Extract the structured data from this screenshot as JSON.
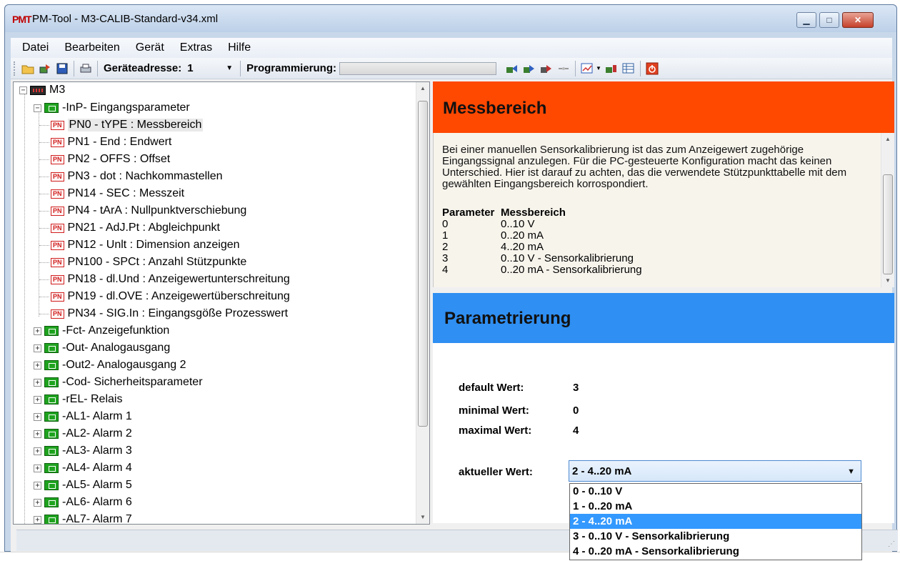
{
  "window": {
    "logo": "PMT",
    "title": "PM-Tool - M3-CALIB-Standard-v34.xml",
    "controls": {
      "minimize": "▁",
      "maximize": "□",
      "close": "✕"
    }
  },
  "menu": [
    "Datei",
    "Bearbeiten",
    "Gerät",
    "Extras",
    "Hilfe"
  ],
  "toolbar": {
    "address_label": "Geräteadresse:",
    "address_value": "1",
    "programming_label": "Programmierung:",
    "icons": [
      "open-folder-icon",
      "device-read-icon",
      "save-icon",
      "print-icon",
      "device-transfer-icon",
      "device-sync-icon",
      "device-upload-icon",
      "disconnect-icon",
      "chart-icon",
      "device-download-icon",
      "table-icon",
      "power-icon"
    ]
  },
  "tree": {
    "root": "M3",
    "groups": [
      {
        "label": "-InP- Eingangsparameter",
        "expanded": true,
        "children": [
          "PN0 - tYPE : Messbereich",
          "PN1 - End : Endwert",
          "PN2 - OFFS : Offset",
          "PN3 - dot : Nachkommastellen",
          "PN14 - SEC : Messzeit",
          "PN4 - tArA : Nullpunktverschiebung",
          "PN21 - AdJ.Pt : Abgleichpunkt",
          "PN12 - Unlt : Dimension anzeigen",
          "PN100 - SPCt : Anzahl Stützpunkte",
          "PN18 - dl.Und : Anzeigewertunterschreitung",
          "PN19 - dl.OVE : Anzeigewertüberschreitung",
          "PN34 - SIG.In : Eingangsgöße Prozesswert"
        ]
      },
      {
        "label": "-Fct- Anzeigefunktion"
      },
      {
        "label": "-Out- Analogausgang"
      },
      {
        "label": "-Out2- Analogausgang 2"
      },
      {
        "label": "-Cod- Sicherheitsparameter"
      },
      {
        "label": "-rEL- Relais"
      },
      {
        "label": "-AL1- Alarm 1"
      },
      {
        "label": "-AL2- Alarm 2"
      },
      {
        "label": "-AL3- Alarm 3"
      },
      {
        "label": "-AL4- Alarm 4"
      },
      {
        "label": "-AL5- Alarm 5"
      },
      {
        "label": "-AL6- Alarm 6"
      },
      {
        "label": "-AL7- Alarm 7"
      }
    ],
    "pn_badge": "PN"
  },
  "messbereich": {
    "title": "Messbereich",
    "description": "Bei einer manuellen Sensorkalibrierung ist das zum Anzeigewert zugehörige Eingangssignal anzulegen. Für die PC-gesteuerte Konfiguration macht das keinen Unterschied. Hier ist darauf zu achten, das die verwendete Stützpunkttabelle mit dem gewählten Eingangsbereich korrospondiert.",
    "table_header": {
      "col1": "Parameter",
      "col2": "Messbereich"
    },
    "table_rows": [
      {
        "param": "0",
        "range": "0..10 V"
      },
      {
        "param": "1",
        "range": "0..20 mA"
      },
      {
        "param": "2",
        "range": "4..20 mA"
      },
      {
        "param": "3",
        "range": "0..10 V - Sensorkalibrierung"
      },
      {
        "param": "4",
        "range": "0..20 mA - Sensorkalibrierung"
      }
    ]
  },
  "parametrierung": {
    "title": "Parametrierung",
    "default_label": "default Wert:",
    "default_value": "3",
    "min_label": "minimal Wert:",
    "min_value": "0",
    "max_label": "maximal Wert:",
    "max_value": "4",
    "current_label": "aktueller Wert:",
    "current_value": "2 - 4..20 mA",
    "options": [
      "0 - 0..10 V",
      "1 - 0..20 mA",
      "2 - 4..20 mA",
      "3 - 0..10 V - Sensorkalibrierung",
      "4 - 0..20 mA - Sensorkalibrierung"
    ],
    "selected_index": 2
  },
  "colors": {
    "messbereich_header": "#ff4800",
    "parametrierung_header": "#2f8ff2",
    "selection": "#3399ff"
  }
}
